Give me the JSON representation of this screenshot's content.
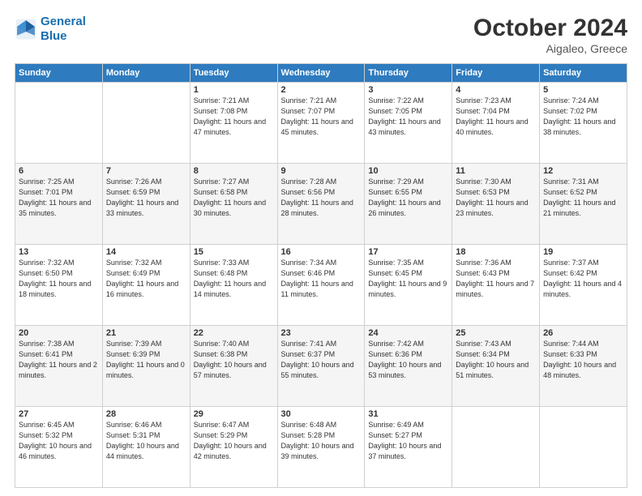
{
  "header": {
    "logo_line1": "General",
    "logo_line2": "Blue",
    "month": "October 2024",
    "location": "Aigaleo, Greece"
  },
  "days_of_week": [
    "Sunday",
    "Monday",
    "Tuesday",
    "Wednesday",
    "Thursday",
    "Friday",
    "Saturday"
  ],
  "weeks": [
    [
      {
        "day": "",
        "sunrise": "",
        "sunset": "",
        "daylight": ""
      },
      {
        "day": "",
        "sunrise": "",
        "sunset": "",
        "daylight": ""
      },
      {
        "day": "1",
        "sunrise": "Sunrise: 7:21 AM",
        "sunset": "Sunset: 7:08 PM",
        "daylight": "Daylight: 11 hours and 47 minutes."
      },
      {
        "day": "2",
        "sunrise": "Sunrise: 7:21 AM",
        "sunset": "Sunset: 7:07 PM",
        "daylight": "Daylight: 11 hours and 45 minutes."
      },
      {
        "day": "3",
        "sunrise": "Sunrise: 7:22 AM",
        "sunset": "Sunset: 7:05 PM",
        "daylight": "Daylight: 11 hours and 43 minutes."
      },
      {
        "day": "4",
        "sunrise": "Sunrise: 7:23 AM",
        "sunset": "Sunset: 7:04 PM",
        "daylight": "Daylight: 11 hours and 40 minutes."
      },
      {
        "day": "5",
        "sunrise": "Sunrise: 7:24 AM",
        "sunset": "Sunset: 7:02 PM",
        "daylight": "Daylight: 11 hours and 38 minutes."
      }
    ],
    [
      {
        "day": "6",
        "sunrise": "Sunrise: 7:25 AM",
        "sunset": "Sunset: 7:01 PM",
        "daylight": "Daylight: 11 hours and 35 minutes."
      },
      {
        "day": "7",
        "sunrise": "Sunrise: 7:26 AM",
        "sunset": "Sunset: 6:59 PM",
        "daylight": "Daylight: 11 hours and 33 minutes."
      },
      {
        "day": "8",
        "sunrise": "Sunrise: 7:27 AM",
        "sunset": "Sunset: 6:58 PM",
        "daylight": "Daylight: 11 hours and 30 minutes."
      },
      {
        "day": "9",
        "sunrise": "Sunrise: 7:28 AM",
        "sunset": "Sunset: 6:56 PM",
        "daylight": "Daylight: 11 hours and 28 minutes."
      },
      {
        "day": "10",
        "sunrise": "Sunrise: 7:29 AM",
        "sunset": "Sunset: 6:55 PM",
        "daylight": "Daylight: 11 hours and 26 minutes."
      },
      {
        "day": "11",
        "sunrise": "Sunrise: 7:30 AM",
        "sunset": "Sunset: 6:53 PM",
        "daylight": "Daylight: 11 hours and 23 minutes."
      },
      {
        "day": "12",
        "sunrise": "Sunrise: 7:31 AM",
        "sunset": "Sunset: 6:52 PM",
        "daylight": "Daylight: 11 hours and 21 minutes."
      }
    ],
    [
      {
        "day": "13",
        "sunrise": "Sunrise: 7:32 AM",
        "sunset": "Sunset: 6:50 PM",
        "daylight": "Daylight: 11 hours and 18 minutes."
      },
      {
        "day": "14",
        "sunrise": "Sunrise: 7:32 AM",
        "sunset": "Sunset: 6:49 PM",
        "daylight": "Daylight: 11 hours and 16 minutes."
      },
      {
        "day": "15",
        "sunrise": "Sunrise: 7:33 AM",
        "sunset": "Sunset: 6:48 PM",
        "daylight": "Daylight: 11 hours and 14 minutes."
      },
      {
        "day": "16",
        "sunrise": "Sunrise: 7:34 AM",
        "sunset": "Sunset: 6:46 PM",
        "daylight": "Daylight: 11 hours and 11 minutes."
      },
      {
        "day": "17",
        "sunrise": "Sunrise: 7:35 AM",
        "sunset": "Sunset: 6:45 PM",
        "daylight": "Daylight: 11 hours and 9 minutes."
      },
      {
        "day": "18",
        "sunrise": "Sunrise: 7:36 AM",
        "sunset": "Sunset: 6:43 PM",
        "daylight": "Daylight: 11 hours and 7 minutes."
      },
      {
        "day": "19",
        "sunrise": "Sunrise: 7:37 AM",
        "sunset": "Sunset: 6:42 PM",
        "daylight": "Daylight: 11 hours and 4 minutes."
      }
    ],
    [
      {
        "day": "20",
        "sunrise": "Sunrise: 7:38 AM",
        "sunset": "Sunset: 6:41 PM",
        "daylight": "Daylight: 11 hours and 2 minutes."
      },
      {
        "day": "21",
        "sunrise": "Sunrise: 7:39 AM",
        "sunset": "Sunset: 6:39 PM",
        "daylight": "Daylight: 11 hours and 0 minutes."
      },
      {
        "day": "22",
        "sunrise": "Sunrise: 7:40 AM",
        "sunset": "Sunset: 6:38 PM",
        "daylight": "Daylight: 10 hours and 57 minutes."
      },
      {
        "day": "23",
        "sunrise": "Sunrise: 7:41 AM",
        "sunset": "Sunset: 6:37 PM",
        "daylight": "Daylight: 10 hours and 55 minutes."
      },
      {
        "day": "24",
        "sunrise": "Sunrise: 7:42 AM",
        "sunset": "Sunset: 6:36 PM",
        "daylight": "Daylight: 10 hours and 53 minutes."
      },
      {
        "day": "25",
        "sunrise": "Sunrise: 7:43 AM",
        "sunset": "Sunset: 6:34 PM",
        "daylight": "Daylight: 10 hours and 51 minutes."
      },
      {
        "day": "26",
        "sunrise": "Sunrise: 7:44 AM",
        "sunset": "Sunset: 6:33 PM",
        "daylight": "Daylight: 10 hours and 48 minutes."
      }
    ],
    [
      {
        "day": "27",
        "sunrise": "Sunrise: 6:45 AM",
        "sunset": "Sunset: 5:32 PM",
        "daylight": "Daylight: 10 hours and 46 minutes."
      },
      {
        "day": "28",
        "sunrise": "Sunrise: 6:46 AM",
        "sunset": "Sunset: 5:31 PM",
        "daylight": "Daylight: 10 hours and 44 minutes."
      },
      {
        "day": "29",
        "sunrise": "Sunrise: 6:47 AM",
        "sunset": "Sunset: 5:29 PM",
        "daylight": "Daylight: 10 hours and 42 minutes."
      },
      {
        "day": "30",
        "sunrise": "Sunrise: 6:48 AM",
        "sunset": "Sunset: 5:28 PM",
        "daylight": "Daylight: 10 hours and 39 minutes."
      },
      {
        "day": "31",
        "sunrise": "Sunrise: 6:49 AM",
        "sunset": "Sunset: 5:27 PM",
        "daylight": "Daylight: 10 hours and 37 minutes."
      },
      {
        "day": "",
        "sunrise": "",
        "sunset": "",
        "daylight": ""
      },
      {
        "day": "",
        "sunrise": "",
        "sunset": "",
        "daylight": ""
      }
    ]
  ]
}
